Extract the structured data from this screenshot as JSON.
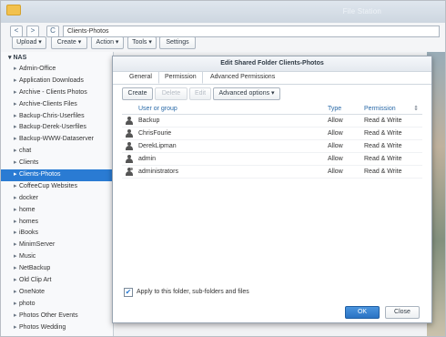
{
  "app": {
    "title": "File Station"
  },
  "nav": {
    "back": "<",
    "forward": ">",
    "refresh": "C",
    "path": "Clients-Photos"
  },
  "toolbar": {
    "upload": "Upload ▾",
    "create": "Create ▾",
    "action": "Action ▾",
    "tools": "Tools ▾",
    "settings": "Settings"
  },
  "tree": {
    "root": "NAS",
    "items": [
      "Admin-Office",
      "Application Downloads",
      "Archive - Clients Photos",
      "Archive-Clients Files",
      "Backup-Chris-Userfiles",
      "Backup-Derek-Userfiles",
      "Backup-WWW-Dataserver",
      "chat",
      "Clients",
      "Clients-Photos",
      "CoffeeCup Websites",
      "docker",
      "home",
      "homes",
      "iBooks",
      "MinimServer",
      "Music",
      "NetBackup",
      "Old Clip Art",
      "OneNote",
      "photo",
      "Photos Other Events",
      "Photos Wedding"
    ],
    "selected_index": 9
  },
  "dialog": {
    "title": "Edit Shared Folder Clients-Photos",
    "tabs": [
      "General",
      "Permission",
      "Advanced Permissions"
    ],
    "active_tab": 1,
    "buttons": {
      "create": "Create",
      "delete": "Delete",
      "edit": "Edit",
      "advanced": "Advanced options ▾"
    },
    "columns": [
      "User or group",
      "Type",
      "Permission"
    ],
    "rows": [
      {
        "icon": "user-icon",
        "name": "Backup",
        "type": "Allow",
        "permission": "Read & Write"
      },
      {
        "icon": "user-icon",
        "name": "ChrisFourie",
        "type": "Allow",
        "permission": "Read & Write"
      },
      {
        "icon": "user-icon",
        "name": "DerekLipman",
        "type": "Allow",
        "permission": "Read & Write"
      },
      {
        "icon": "user-icon",
        "name": "admin",
        "type": "Allow",
        "permission": "Read & Write"
      },
      {
        "icon": "group-icon",
        "name": "administrators",
        "type": "Allow",
        "permission": "Read & Write"
      }
    ],
    "apply_label": "Apply to this folder, sub-folders and files",
    "apply_checked": true,
    "ok": "OK",
    "close": "Close"
  }
}
